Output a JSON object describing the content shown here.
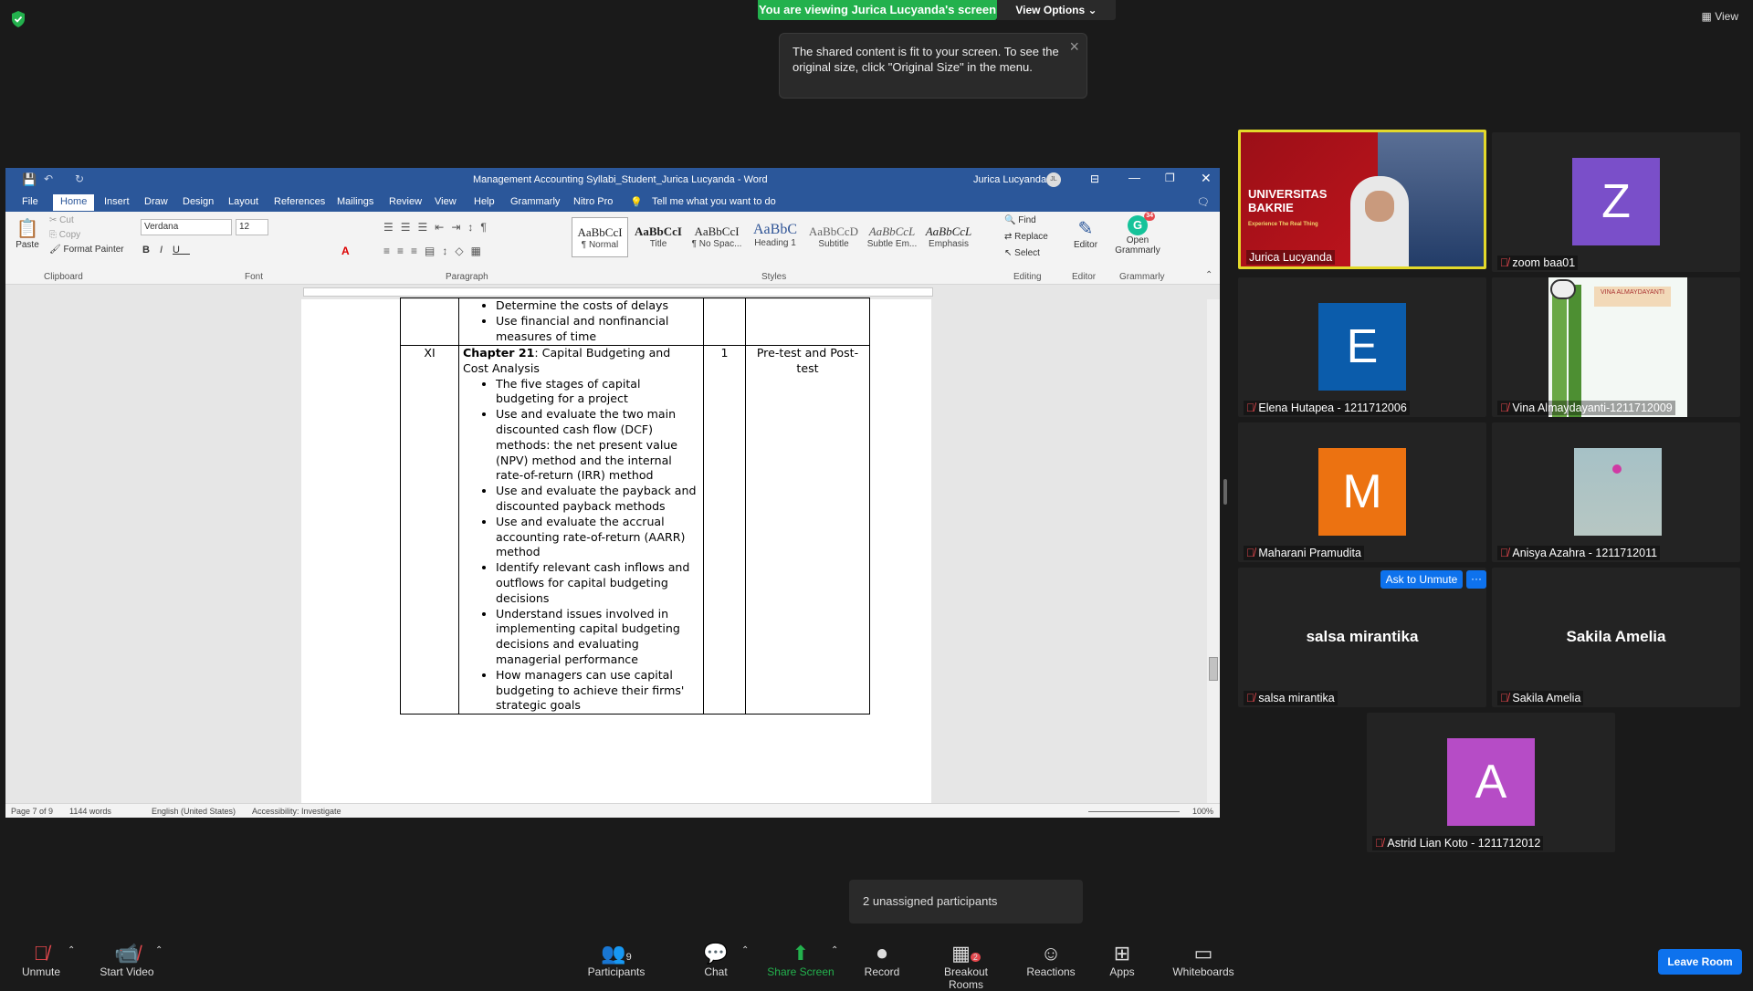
{
  "top_bar": {
    "viewing_banner": "You are viewing Jurica Lucyanda's screen",
    "view_options": "View Options",
    "view_label": "View",
    "tooltip_text": "The shared content is fit to your screen. To see the original size, click \"Original Size\" in the menu."
  },
  "word": {
    "title": "Management Accounting Syllabi_Student_Jurica Lucyanda  -  Word",
    "user": "Jurica Lucyanda",
    "user_initials": "JL",
    "tabs": [
      "File",
      "Home",
      "Insert",
      "Draw",
      "Design",
      "Layout",
      "References",
      "Mailings",
      "Review",
      "View",
      "Help",
      "Grammarly",
      "Nitro Pro"
    ],
    "tell_me": "Tell me what you want to do",
    "ribbon": {
      "clipboard": {
        "paste": "Paste",
        "cut": "Cut",
        "copy": "Copy",
        "format_painter": "Format Painter",
        "label": "Clipboard"
      },
      "font": {
        "family": "Verdana",
        "size": "12",
        "label": "Font"
      },
      "paragraph_label": "Paragraph",
      "styles": [
        {
          "preview": "AaBbCcI",
          "name": "¶ Normal"
        },
        {
          "preview": "AaBbCcI",
          "name": "Title"
        },
        {
          "preview": "AaBbCcI",
          "name": "¶ No Spac..."
        },
        {
          "preview": "AaBbC",
          "name": "Heading 1"
        },
        {
          "preview": "AaBbCcD",
          "name": "Subtitle"
        },
        {
          "preview": "AaBbCcL",
          "name": "Subtle Em..."
        },
        {
          "preview": "AaBbCcL",
          "name": "Emphasis"
        }
      ],
      "styles_label": "Styles",
      "editing": {
        "find": "Find",
        "replace": "Replace",
        "select": "Select",
        "label": "Editing"
      },
      "editor": {
        "button": "Editor",
        "label": "Editor"
      },
      "grammarly": {
        "button": "Open Grammarly",
        "badge": "34",
        "label": "Grammarly"
      }
    },
    "table": {
      "prev_bullets": [
        "Determine the costs of delays",
        "Use financial and nonfinancial measures of time"
      ],
      "row": {
        "session": "XI",
        "chapter_bold": "Chapter 21",
        "chapter_rest": ": Capital Budgeting and Cost Analysis",
        "bullets": [
          "The five stages of capital budgeting for a project",
          "Use and evaluate the two main discounted cash flow (DCF) methods: the net present value (NPV) method and the internal rate-of-return (IRR) method",
          "Use and evaluate the payback and discounted payback methods",
          "Use and evaluate the accrual accounting rate-of-return (AARR) method",
          "Identify relevant cash inflows and outflows for capital budgeting decisions",
          "Understand issues involved in implementing capital budgeting decisions and evaluating managerial performance",
          "How managers can use capital budgeting to achieve their firms' strategic goals"
        ],
        "weeks": "1",
        "assessment": "Pre-test and Post-test"
      }
    },
    "status": {
      "page": "Page 7 of 9",
      "words": "1144 words",
      "language": "English (United States)",
      "accessibility": "Accessibility: Investigate",
      "zoom": "100%"
    }
  },
  "participants": [
    {
      "name": "Jurica Lucyanda",
      "type": "video",
      "banner_line1": "UNIVERSITAS",
      "banner_line2": "BAKRIE",
      "banner_tag": "Experience The Real Thing",
      "highlight": "#e3d92b"
    },
    {
      "name": "zoom baa01",
      "type": "avatar",
      "letter": "Z",
      "color": "#7a4fc9"
    },
    {
      "name": "Elena Hutapea - 1211712006",
      "type": "avatar",
      "letter": "E",
      "color": "#0b5cab"
    },
    {
      "name": "Vina Almaydayanti-1211712009",
      "type": "image",
      "caption": "VINA ALMAYDAYANTI"
    },
    {
      "name": "Maharani Pramudita",
      "type": "avatar",
      "letter": "M",
      "color": "#ec7211"
    },
    {
      "name": "Anisya Azahra - 1211712011",
      "type": "image"
    },
    {
      "name": "salsa mirantika",
      "type": "name"
    },
    {
      "name": "Sakila Amelia",
      "type": "name"
    },
    {
      "name": "Astrid Lian Koto - 1211712012",
      "type": "avatar",
      "letter": "A",
      "color": "#b64cc6"
    }
  ],
  "ask_to_unmute": "Ask to Unmute",
  "ask_more": "···",
  "unassigned": "2 unassigned participants",
  "toolbar": {
    "unmute": "Unmute",
    "start_video": "Start Video",
    "participants": "Participants",
    "participants_count": "9",
    "chat": "Chat",
    "share_screen": "Share Screen",
    "record": "Record",
    "breakout_rooms": "Breakout Rooms",
    "breakout_badge": "2",
    "reactions": "Reactions",
    "apps": "Apps",
    "whiteboards": "Whiteboards",
    "leave_room": "Leave Room"
  }
}
